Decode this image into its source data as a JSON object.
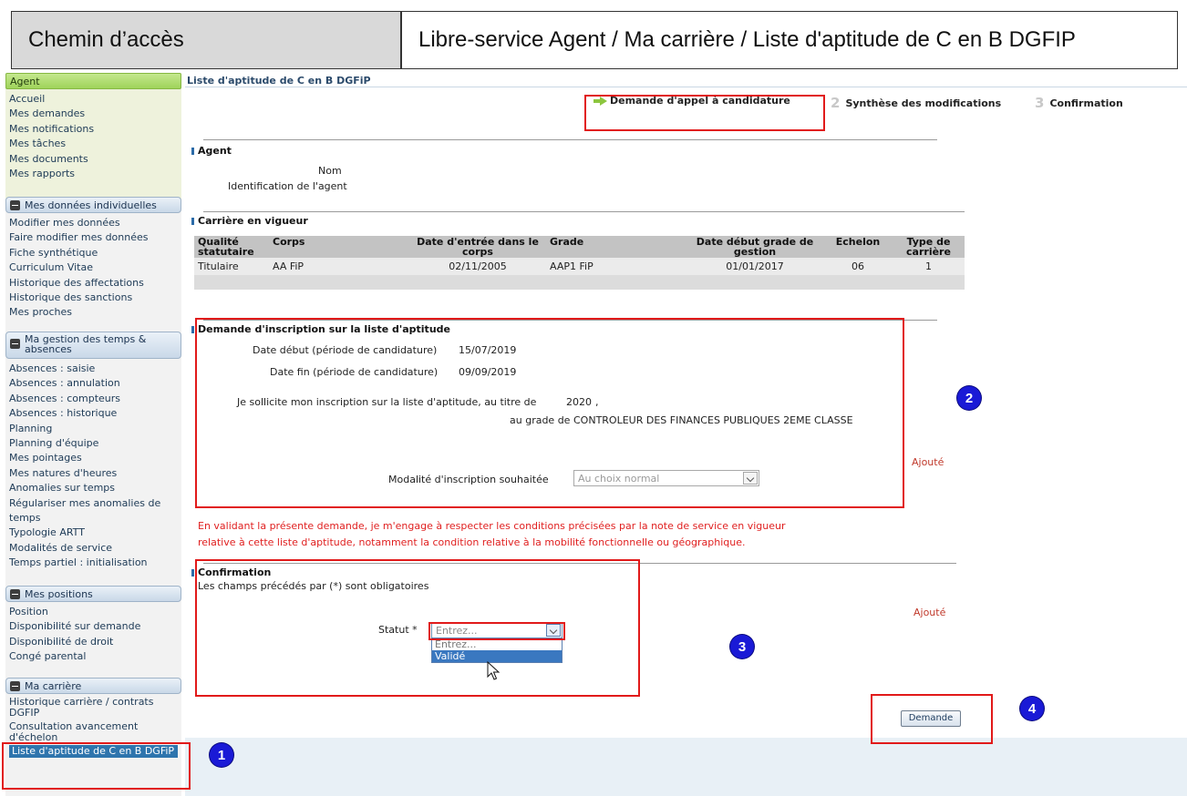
{
  "header": {
    "left_title": "Chemin d’accès",
    "path": "Libre-service Agent / Ma carrière / Liste d'aptitude de C en B DGFIP"
  },
  "sidebar": {
    "agent": {
      "title": "Agent",
      "items": [
        "Accueil",
        "Mes demandes",
        "Mes notifications",
        "Mes tâches",
        "Mes documents",
        "Mes rapports"
      ]
    },
    "donnees": {
      "title": "Mes données individuelles",
      "items": [
        "Modifier mes données",
        "Faire modifier mes données",
        "Fiche synthétique",
        "Curriculum Vitae",
        "Historique des affectations",
        "Historique des sanctions",
        "Mes proches"
      ]
    },
    "temps": {
      "title": "Ma gestion des temps & absences",
      "items": [
        "Absences : saisie",
        "Absences : annulation",
        "Absences : compteurs",
        "Absences : historique",
        "Planning",
        "Planning d'équipe",
        "Mes pointages",
        "Mes natures d'heures",
        "Anomalies sur temps",
        "Régulariser mes anomalies de temps",
        "Typologie ARTT",
        "Modalités de service",
        "Temps partiel : initialisation"
      ]
    },
    "positions": {
      "title": "Mes positions",
      "items": [
        "Position",
        "Disponibilité sur demande",
        "Disponibilité de droit",
        "Congé parental"
      ]
    },
    "carriere": {
      "title": "Ma carrière",
      "items": [
        "Historique carrière / contrats DGFIP",
        "Consultation avancement d'échelon"
      ],
      "active_item": "Liste d'aptitude de C en B DGFiP"
    }
  },
  "main": {
    "page_title": "Liste d'aptitude de C en B DGFiP",
    "steps": [
      {
        "num": "",
        "label": "Demande d'appel à candidature"
      },
      {
        "num": "2",
        "label": "Synthèse des modifications"
      },
      {
        "num": "3",
        "label": "Confirmation"
      }
    ],
    "agent_section": {
      "title": "Agent",
      "nom_label": "Nom",
      "id_label": "Identification de l'agent"
    },
    "carriere_section": {
      "title": "Carrière en vigueur",
      "columns": [
        "Qualité statutaire",
        "Corps",
        "Date d'entrée dans le corps",
        "Grade",
        "Date début grade de gestion",
        "Echelon",
        "Type de carrière"
      ],
      "rows": [
        [
          "Titulaire",
          "AA FiP",
          "02/11/2005",
          "AAP1 FiP",
          "01/01/2017",
          "06",
          "1"
        ]
      ]
    },
    "inscription": {
      "title": "Demande d'inscription sur la liste d'aptitude",
      "date_debut_label": "Date début (période de candidature)",
      "date_debut": "15/07/2019",
      "date_fin_label": "Date fin (période de candidature)",
      "date_fin": "09/09/2019",
      "sollicite_text": "Je sollicite mon inscription sur la liste d'aptitude, au titre de",
      "annee": "2020",
      "comma": ",",
      "grade_label": "au grade de",
      "grade": "CONTROLEUR DES FINANCES PUBLIQUES 2EME CLASSE",
      "modalite_label": "Modalité d'inscription souhaitée",
      "modalite_value": "Au choix normal",
      "ajoute": "Ajouté"
    },
    "warning_line1": "En validant la présente demande, je m'engage à respecter les conditions précisées par la note de service en vigueur",
    "warning_line2": "relative à cette liste d'aptitude, notamment la condition relative à la mobilité fonctionnelle ou géographique.",
    "confirmation": {
      "title": "Confirmation",
      "note": "Les champs précédés par (*) sont obligatoires",
      "ajoute": "Ajouté",
      "statut_label": "Statut *",
      "statut_placeholder": "Entrez...",
      "options": [
        "Entrez...",
        "Validé"
      ]
    },
    "submit_label": "Demande"
  },
  "badges": [
    "1",
    "2",
    "3",
    "4"
  ],
  "colors": {
    "annotation_red": "#e11a1a",
    "badge_blue": "#1a1ad6",
    "active_item": "#2e75ad",
    "warning_text": "#e02020"
  }
}
